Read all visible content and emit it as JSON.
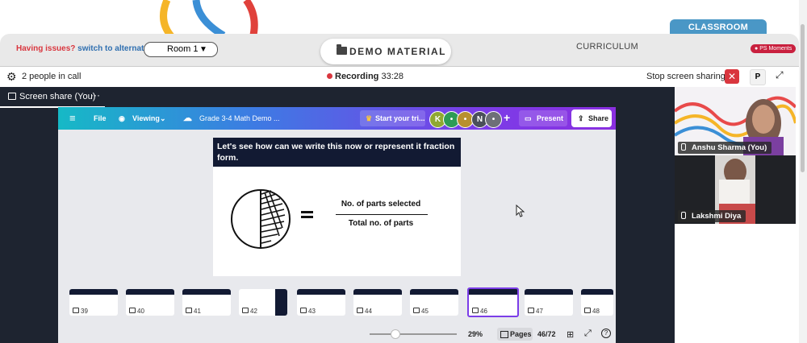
{
  "header": {
    "classroom_tab": "CLASSROOM",
    "issues_label": "Having issues?",
    "alternate_link": "switch to alternate room",
    "room_select": "Room 1",
    "demo_material": "DEMO MATERIAL",
    "curriculum": "CURRICULUM",
    "moments_badge": "PS Moments"
  },
  "callbar": {
    "people": "2 people in call",
    "recording_label": "Recording",
    "recording_time": "33:28",
    "stop_sharing": "Stop screen sharing",
    "p_button": "P"
  },
  "share_tab": {
    "label": "Screen share (You)",
    "more": "···"
  },
  "canva": {
    "file": "File",
    "viewing": "Viewing",
    "doc_title": "Grade 3-4 Math Demo ...",
    "start_trial": "Start your tri...",
    "avatars": [
      "K",
      "",
      "",
      "N",
      ""
    ],
    "add": "+",
    "present": "Present",
    "share": "Share"
  },
  "slide": {
    "heading": "Let's see how can we write this now or represent it fraction form.",
    "numerator": "No. of parts selected",
    "denominator": "Total no. of parts"
  },
  "thumbnails": [
    "39",
    "40",
    "41",
    "42",
    "43",
    "44",
    "45",
    "46",
    "47",
    "48"
  ],
  "footer": {
    "zoom": "29%",
    "pages": "Pages",
    "page_count": "46/72"
  },
  "participants": [
    {
      "name": "Anshu Sharma (You)"
    },
    {
      "name": "Lakshmi Diya"
    }
  ],
  "colors": {
    "accent_red": "#d9363e",
    "classroom_blue": "#4a97c6",
    "canva_purple": "#7b3de8",
    "canva_teal": "#16b9c6",
    "slide_navy": "#121a33"
  }
}
